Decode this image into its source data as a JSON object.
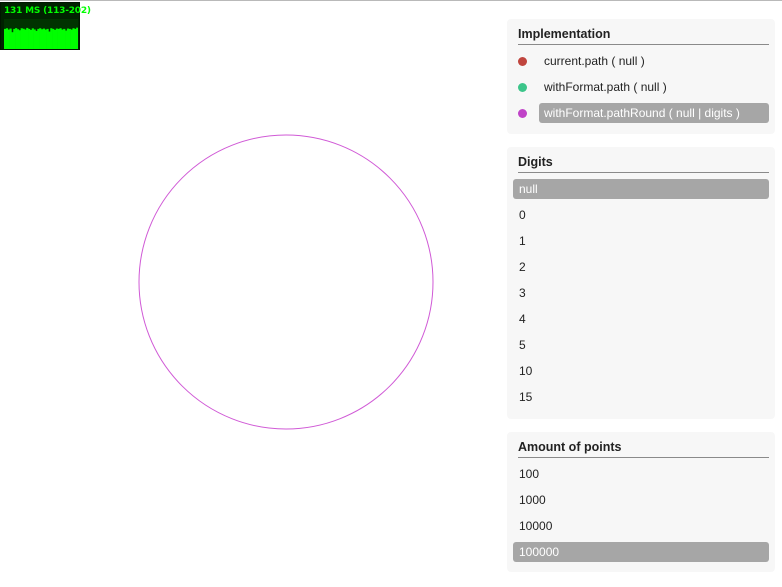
{
  "fps": {
    "label": "131 MS (113-202)",
    "color": "#00ff00",
    "samples_ms": [
      150,
      140,
      160,
      145,
      200,
      150,
      138,
      155,
      170,
      140,
      148,
      160,
      135,
      150,
      165,
      142,
      158,
      180,
      150,
      140,
      155,
      145,
      160,
      150,
      190,
      140,
      150,
      165,
      145,
      150,
      140,
      160,
      150,
      175,
      145,
      150,
      160,
      140,
      150,
      131
    ]
  },
  "implementation": {
    "title": "Implementation",
    "items": [
      {
        "label": "current.path ( null )",
        "color": "#c0453e",
        "active": false
      },
      {
        "label": "withFormat.path ( null )",
        "color": "#3cc58a",
        "active": false
      },
      {
        "label": "withFormat.pathRound ( null | digits )",
        "color": "#c043c8",
        "active": true
      }
    ]
  },
  "digits": {
    "title": "Digits",
    "options": [
      "null",
      "0",
      "1",
      "2",
      "3",
      "4",
      "5",
      "10",
      "15"
    ],
    "selected": "null"
  },
  "points": {
    "title": "Amount of points",
    "options": [
      "100",
      "1000",
      "10000",
      "100000"
    ],
    "selected": "100000"
  },
  "circle": {
    "stroke": "#d05ad6"
  }
}
